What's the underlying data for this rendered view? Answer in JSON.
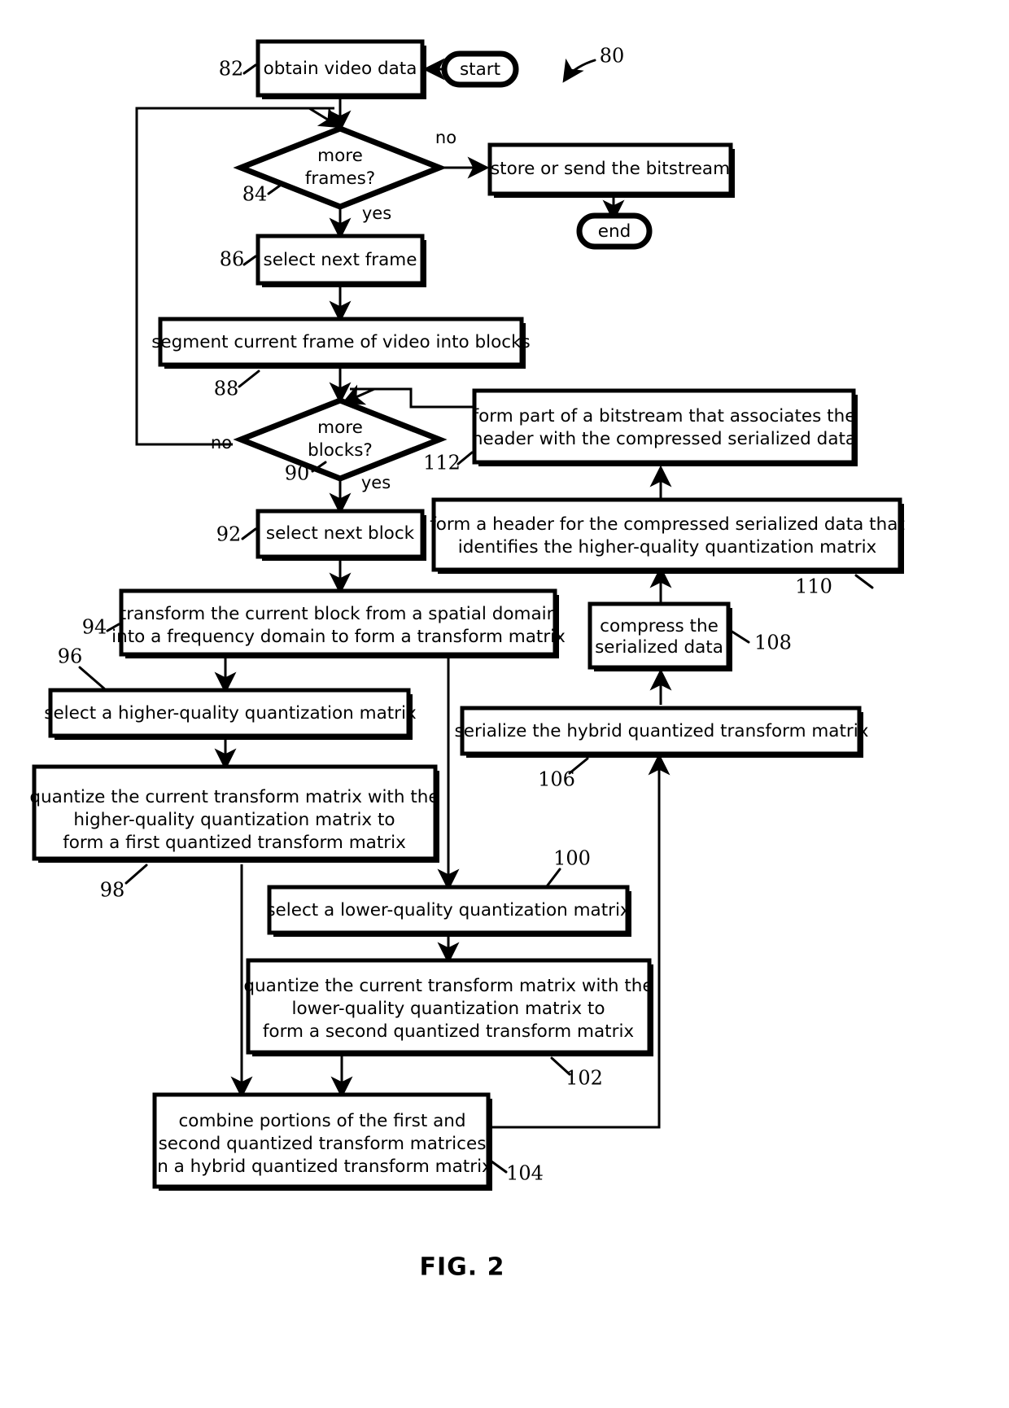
{
  "figure": {
    "caption": "FIG. 2",
    "diagram_ref": "80",
    "type": "patent-flowchart"
  },
  "terminators": {
    "start": "start",
    "end": "end"
  },
  "edge_labels": {
    "frames_no": "no",
    "frames_yes": "yes",
    "blocks_no": "no",
    "blocks_yes": "yes"
  },
  "nodes": [
    {
      "id": "obtain",
      "ref": "82",
      "shape": "process",
      "text": [
        "obtain video data"
      ]
    },
    {
      "id": "more_frames",
      "ref": "84",
      "shape": "decision",
      "text": [
        "more",
        "frames?"
      ]
    },
    {
      "id": "store_send",
      "ref": "",
      "shape": "process",
      "text": [
        "store or send the bitstream"
      ]
    },
    {
      "id": "select_frame",
      "ref": "86",
      "shape": "process",
      "text": [
        "select next frame"
      ]
    },
    {
      "id": "segment",
      "ref": "88",
      "shape": "process",
      "text": [
        "segment current frame of video into blocks"
      ]
    },
    {
      "id": "more_blocks",
      "ref": "90",
      "shape": "decision",
      "text": [
        "more",
        "blocks?"
      ]
    },
    {
      "id": "form_bitstream",
      "ref": "112",
      "shape": "process",
      "text": [
        "form part of a bitstream that associates the",
        "header with the compressed serialized data"
      ]
    },
    {
      "id": "select_block",
      "ref": "92",
      "shape": "process",
      "text": [
        "select next block"
      ]
    },
    {
      "id": "form_header",
      "ref": "110",
      "shape": "process",
      "text": [
        "form a header for the compressed serialized data that",
        "identifies the higher-quality quantization matrix"
      ]
    },
    {
      "id": "transform",
      "ref": "94",
      "shape": "process",
      "text": [
        "transform the current block from a spatial domain",
        "into a frequency domain to form a transform matrix"
      ]
    },
    {
      "id": "compress",
      "ref": "108",
      "shape": "process",
      "text": [
        "compress the",
        "serialized data"
      ]
    },
    {
      "id": "select_high_q",
      "ref": "96",
      "shape": "process",
      "text": [
        "select a higher-quality quantization matrix"
      ]
    },
    {
      "id": "serialize",
      "ref": "106",
      "shape": "process",
      "text": [
        "serialize the hybrid quantized transform matrix"
      ]
    },
    {
      "id": "quantize_high",
      "ref": "98",
      "shape": "process",
      "text": [
        "quantize the current transform matrix with the",
        "higher-quality quantization matrix to",
        "form a first quantized transform matrix"
      ]
    },
    {
      "id": "select_low_q",
      "ref": "100",
      "shape": "process",
      "text": [
        "select a lower-quality quantization matrix"
      ]
    },
    {
      "id": "quantize_low",
      "ref": "102",
      "shape": "process",
      "text": [
        "quantize the current transform matrix with the",
        "lower-quality quantization matrix to",
        "form a second quantized transform matrix"
      ]
    },
    {
      "id": "combine",
      "ref": "104",
      "shape": "process",
      "text": [
        "combine portions of the first and",
        "second quantized transform matrices",
        "in a hybrid quantized transform matrix"
      ]
    }
  ],
  "colors": {
    "stroke": "#000000",
    "fill": "#ffffff",
    "background": "#ffffff"
  }
}
